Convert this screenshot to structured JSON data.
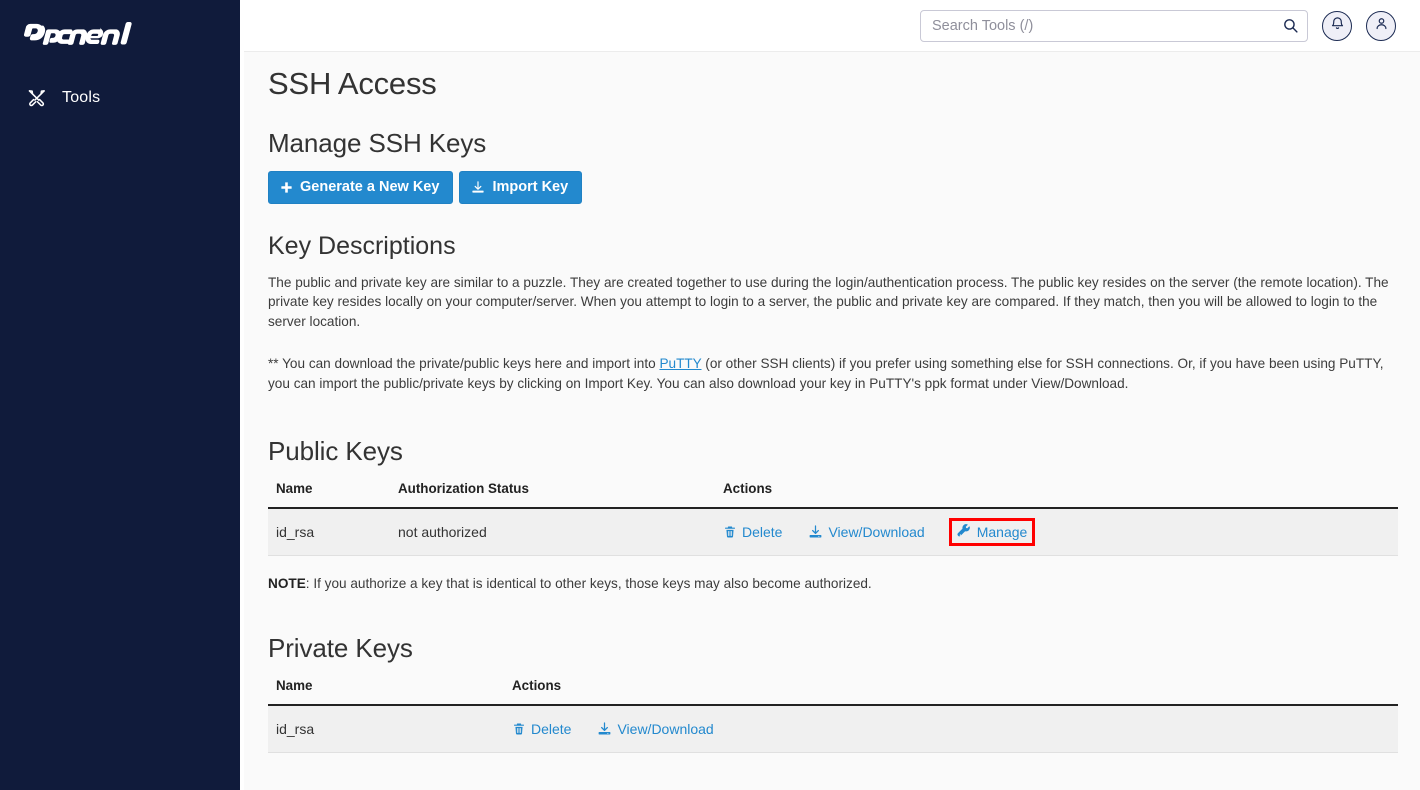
{
  "sidebar": {
    "brand": "cPanel",
    "items": [
      {
        "label": "Tools",
        "icon": "tools-icon"
      }
    ]
  },
  "header": {
    "search": {
      "placeholder": "Search Tools (/)",
      "value": "",
      "icon": "search-icon"
    },
    "notifications_icon": "bell-icon",
    "account_icon": "user-icon"
  },
  "page": {
    "title": "SSH Access",
    "manage_keys": {
      "heading": "Manage SSH Keys",
      "generate_button": "Generate a New Key",
      "import_button": "Import Key"
    },
    "key_descriptions": {
      "heading": "Key Descriptions",
      "paragraph1": "The public and private key are similar to a puzzle. They are created together to use during the login/authentication process. The public key resides on the server (the remote location). The private key resides locally on your computer/server. When you attempt to login to a server, the public and private key are compared. If they match, then you will be allowed to login to the server location.",
      "paragraph2_before_link": "** You can download the private/public keys here and import into ",
      "link_text": "PuTTY",
      "paragraph2_after_link": " (or other SSH clients) if you prefer using something else for SSH connections. Or, if you have been using PuTTY, you can import the public/private keys by clicking on Import Key. You can also download your key in PuTTY's ppk format under View/Download."
    },
    "public_keys": {
      "heading": "Public Keys",
      "columns": [
        "Name",
        "Authorization Status",
        "Actions"
      ],
      "rows": [
        {
          "name": "id_rsa",
          "status": "not authorized",
          "actions": [
            {
              "label": "Delete",
              "icon": "trash-icon",
              "highlighted": false
            },
            {
              "label": "View/Download",
              "icon": "download-icon",
              "highlighted": false
            },
            {
              "label": "Manage",
              "icon": "wrench-icon",
              "highlighted": true
            }
          ]
        }
      ],
      "note_label": "NOTE",
      "note_text": ": If you authorize a key that is identical to other keys, those keys may also become authorized."
    },
    "private_keys": {
      "heading": "Private Keys",
      "columns": [
        "Name",
        "Actions"
      ],
      "rows": [
        {
          "name": "id_rsa",
          "actions": [
            {
              "label": "Delete",
              "icon": "trash-icon"
            },
            {
              "label": "View/Download",
              "icon": "download-icon"
            }
          ]
        }
      ]
    }
  },
  "colors": {
    "sidebar_bg": "#101B3B",
    "accent_blue": "#2389CE",
    "link_blue": "#2389CE",
    "highlight_red": "#FF0000",
    "row_bg": "#F0F0F0",
    "content_bg": "#FAFAFA"
  }
}
